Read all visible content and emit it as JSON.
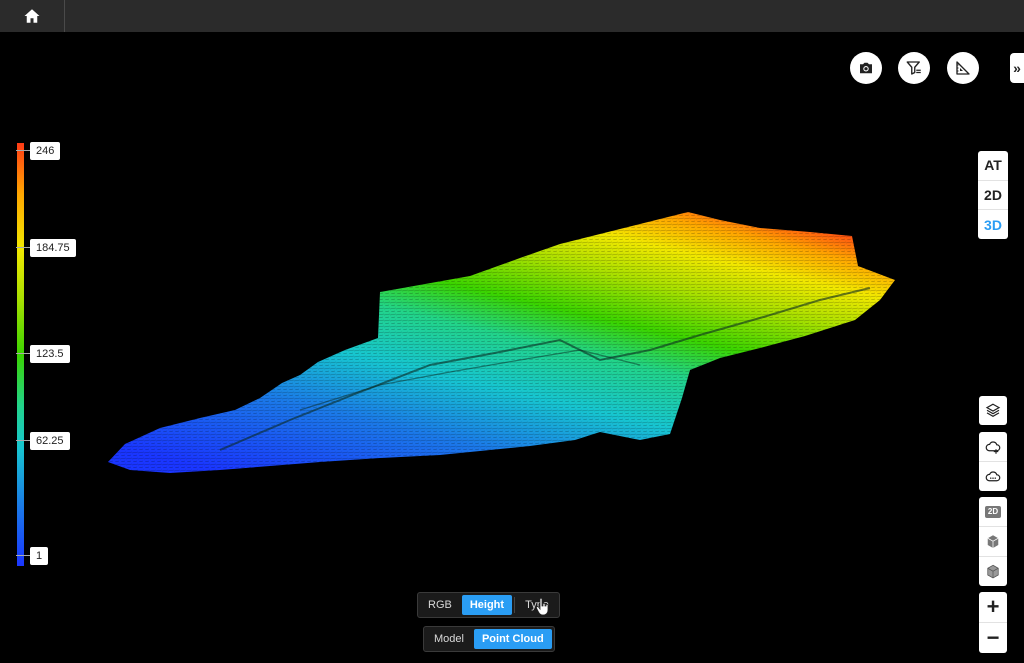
{
  "topbar": {
    "home_icon": "home-icon"
  },
  "tools": {
    "camera_icon": "camera-icon",
    "filter_icon": "filter-icon",
    "measure_icon": "measure-icon",
    "expand_label": "»"
  },
  "view_modes": [
    {
      "label": "AT",
      "active": false
    },
    {
      "label": "2D",
      "active": false
    },
    {
      "label": "3D",
      "active": true
    }
  ],
  "side_tools": {
    "layers_icon": "layers-cube-icon",
    "cloud_add_icon": "cloud-add-icon",
    "cloud_remove_icon": "cloud-remove-icon",
    "badge_2d": "2D",
    "cube_icon": "cube-icon",
    "cube_alt_icon": "cube-outline-icon",
    "zoom_in": "+",
    "zoom_out": "−"
  },
  "legend": {
    "ticks": [
      "246",
      "184.75",
      "123.5",
      "62.25",
      "1"
    ],
    "colors": {
      "high": "#ff3b16",
      "mid": "#3ad400",
      "low": "#1a36ff"
    }
  },
  "color_modes": {
    "options": [
      "RGB",
      "Height",
      "Type"
    ],
    "active": "Height"
  },
  "display_modes": {
    "options": [
      "Model",
      "Point Cloud"
    ],
    "active": "Point Cloud"
  },
  "accent_color": "#2a9df4"
}
